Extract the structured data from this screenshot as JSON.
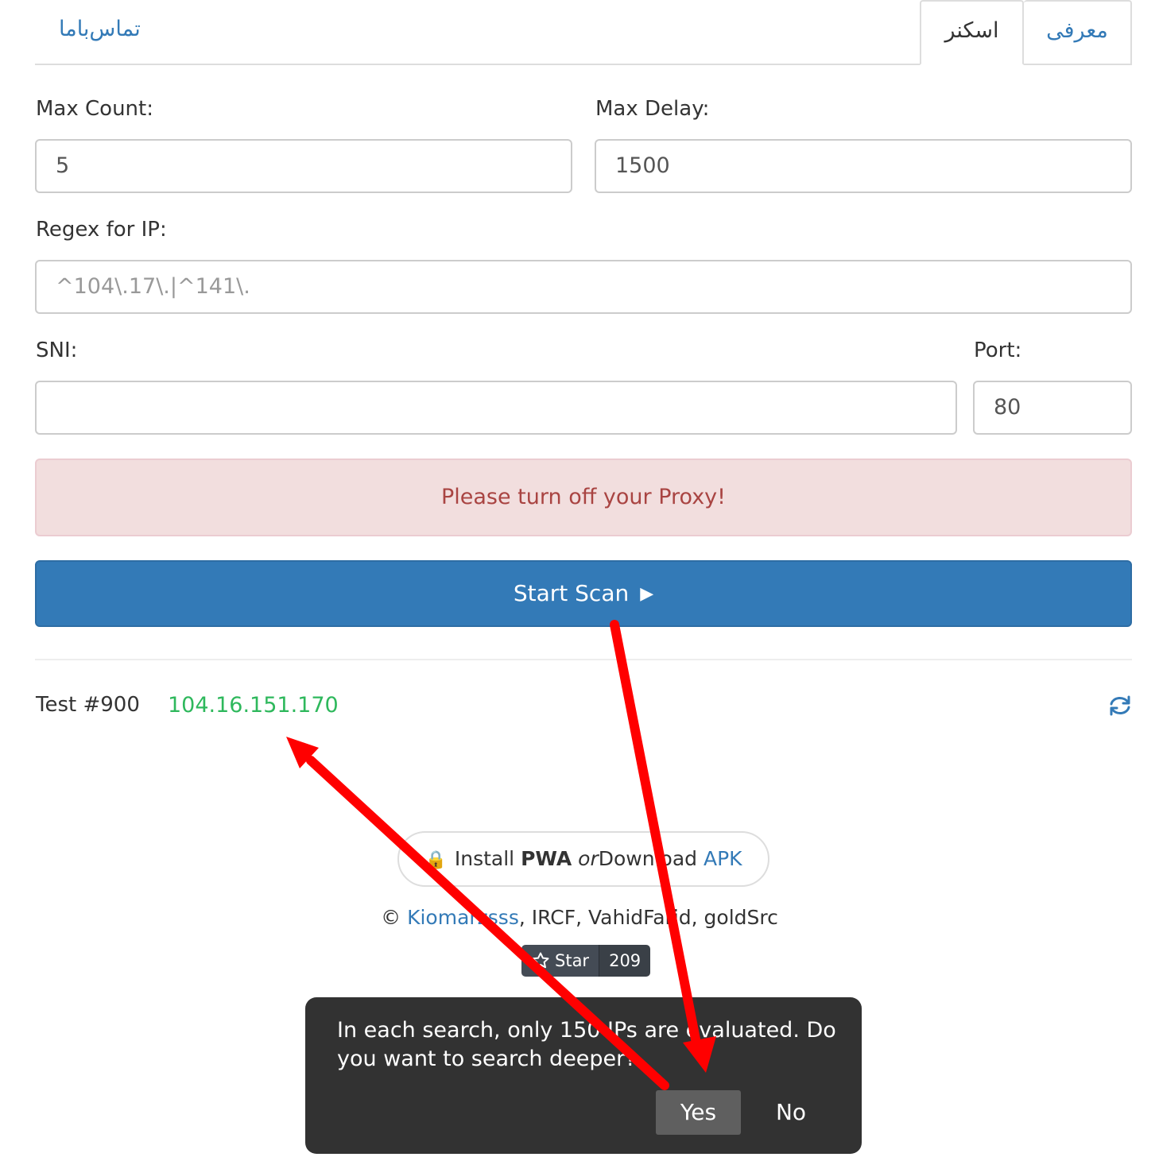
{
  "tabs": {
    "contact": "تماس‌باما",
    "scanner": "اسکنر",
    "intro": "معرفی"
  },
  "form": {
    "max_count_label": "Max Count:",
    "max_count_value": "5",
    "max_delay_label": "Max Delay:",
    "max_delay_value": "1500",
    "regex_label": "Regex for IP:",
    "regex_placeholder": "^104\\.17\\.|^141\\.",
    "sni_label": "SNI:",
    "sni_value": "",
    "port_label": "Port:",
    "port_value": "80"
  },
  "alert": {
    "text": "Please turn off your Proxy!"
  },
  "start_button": {
    "label": "Start Scan",
    "icon": "play-icon"
  },
  "result": {
    "test_label": "Test #900",
    "ip": "104.16.151.170",
    "refresh_icon": "refresh-icon"
  },
  "pwa": {
    "install": "Install",
    "pwa": "PWA",
    "or": "or",
    "download": "Download",
    "apk": "APK",
    "icon": "lock-icon"
  },
  "credits": {
    "copyright": "©",
    "kiomarzsss": "Kiomarzsss",
    "rest": ", IRCF, VahidFarid, goldSrc"
  },
  "github": {
    "star_label": "Star",
    "count": "209"
  },
  "toast": {
    "message": "In each search, only 150 IPs are evaluated. Do you want to search deeper?",
    "yes": "Yes",
    "no": "No"
  },
  "colors": {
    "primary": "#337ab7",
    "success": "#2eb85c",
    "danger_text": "#a94442",
    "arrow": "#ff0000"
  }
}
